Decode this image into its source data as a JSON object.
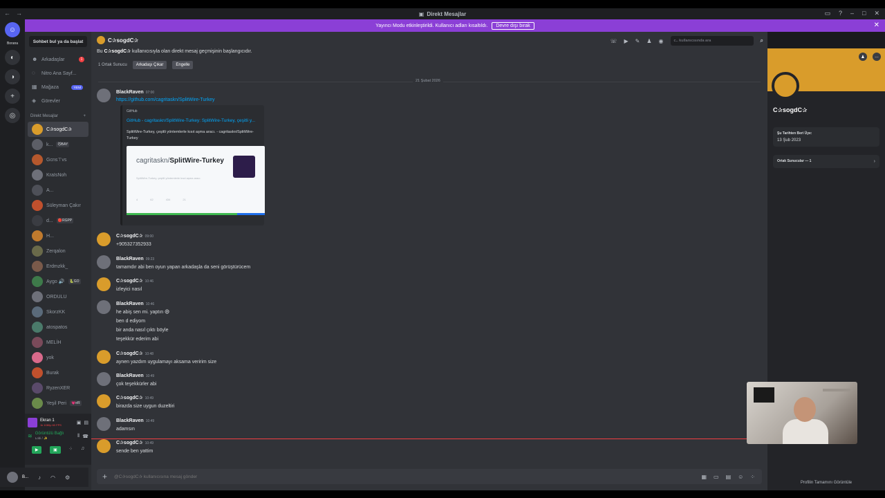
{
  "window": {
    "title": "Direkt Mesajlar"
  },
  "banner": {
    "text": "Yayıncı Modu etkinleştirildi. Kullanıcı adları kısaltıldı.",
    "button": "Devre dışı bırak"
  },
  "rail": {
    "label": "Borana"
  },
  "sidebar": {
    "search": "Sohbet bul ya da başlat",
    "nav": [
      {
        "label": "Arkadaşlar",
        "badge": "1"
      },
      {
        "label": "Nitro Ana Sayf..."
      },
      {
        "label": "Mağaza",
        "badge": "YENİ"
      },
      {
        "label": "Görevler"
      }
    ],
    "dm_header": "Direkt Mesajlar",
    "dms": [
      {
        "name": "C✰sogdC✰",
        "tag": ""
      },
      {
        "name": "k...",
        "tag": "😼BAY"
      },
      {
        "name": "Gcns⊤vs",
        "tag": ""
      },
      {
        "name": "KraIsNoh",
        "tag": ""
      },
      {
        "name": "A...",
        "tag": ""
      },
      {
        "name": "Süleyman Çakır",
        "tag": ""
      },
      {
        "name": "d...",
        "tag": "🔴RGPP"
      },
      {
        "name": "H...",
        "tag": ""
      },
      {
        "name": "Zerqalon",
        "tag": ""
      },
      {
        "name": "Erdmzkk_",
        "tag": ""
      },
      {
        "name": "Aygo 🔊",
        "tag": "🐍GO"
      },
      {
        "name": "ORDULU",
        "tag": ""
      },
      {
        "name": "SkorzKK",
        "tag": ""
      },
      {
        "name": "atospatos",
        "tag": ""
      },
      {
        "name": "MELİH",
        "tag": ""
      },
      {
        "name": "yok",
        "tag": ""
      },
      {
        "name": "Burak",
        "tag": ""
      },
      {
        "name": "RyzenXER",
        "tag": ""
      },
      {
        "name": "Yeşil Peri",
        "tag": "💗eR"
      }
    ],
    "voice": {
      "screen": "Ekran 1",
      "screen_sub": "1k 1080p 60 FPS",
      "connected": "Görüntülü Bağlı",
      "connected_sub": "Lobi / ✨"
    },
    "user": {
      "name": "B..."
    }
  },
  "chat": {
    "header_name": "C✰sogdC✰",
    "search_placeholder": "c.. kullanıcısında ara",
    "intro_pre": "Bu",
    "intro_name": "C✰sogdC✰",
    "intro_post": "kullanıcısıyla olan direkt mesaj geçmişinin başlangıcıdır.",
    "mutual": "1 Ortak Sunucu",
    "btn_remove": "Arkadaşı Çıkar",
    "btn_block": "Engelle",
    "date": "21 Şubat 2026",
    "messages": [
      {
        "user": "BlackRaven",
        "time": "07:00",
        "lines": [],
        "link": "https://github.com/cagritaskn/SplitWire-Turkey"
      },
      {
        "user": "C✰sogdC✰",
        "time": "09:00",
        "lines": [
          "+905327352933"
        ]
      },
      {
        "user": "BlackRaven",
        "time": "09:23",
        "lines": [
          "tamamdır abi ben oyun yapan arkadaşla da seni görüştürücem"
        ]
      },
      {
        "user": "C✰sogdC✰",
        "time": "10:46",
        "lines": [
          "izleyici nasıl"
        ]
      },
      {
        "user": "BlackRaven",
        "time": "10:46",
        "lines": [
          "he abiş sen mi. yaptın 😄",
          "ben d ediyom",
          "bir anda nasıl çıktı böyle",
          "teşekkür ederim abi"
        ]
      },
      {
        "user": "C✰sogdC✰",
        "time": "10:48",
        "lines": [
          "aynen yazdım uygulamayı aksama veririm size"
        ]
      },
      {
        "user": "BlackRaven",
        "time": "10:49",
        "lines": [
          "çok teşekkürler abi"
        ]
      },
      {
        "user": "C✰sogdC✰",
        "time": "10:49",
        "lines": [
          "birazda size uygun duzeltiri"
        ]
      },
      {
        "user": "BlackRaven",
        "time": "10:49",
        "lines": [
          "adamsın"
        ]
      },
      {
        "user": "C✰sogdC✰",
        "time": "10:49",
        "lines": [
          "sende ben yattim"
        ]
      }
    ],
    "embed": {
      "provider": "GitHub",
      "title": "GitHub - cagritaskn/SplitWire-Turkey: SplitWire-Turkey, çeşitli y...",
      "desc": "SplitWire-Turkey, çeşitli yöntemlerle kısıt aşma aracı. - cagritaskn/SplitWire-Turkey",
      "img_owner": "cagritaskn/",
      "img_repo": "SplitWire-Turkey",
      "img_sub": "SplitWire-Turkey, çeşitli yöntemlerle kısıt aşma aracı.",
      "stats": [
        "4",
        "62",
        "434",
        "21"
      ]
    },
    "composer_placeholder": "@C✰sogdC✰ kullanıcısına mesaj gönder"
  },
  "profile": {
    "name": "C✰sogdC✰",
    "since_label": "Şu Tarihten Beri Üye:",
    "since_value": "13 Şub 2023",
    "mutual": "Ortak Sunucular — 1",
    "full": "Profilin Tamamını Görüntüle"
  },
  "colors": {
    "accent": "#5865f2",
    "banner": "#8b3fd6",
    "link": "#00a8fc",
    "new_line": "#f23f42"
  }
}
